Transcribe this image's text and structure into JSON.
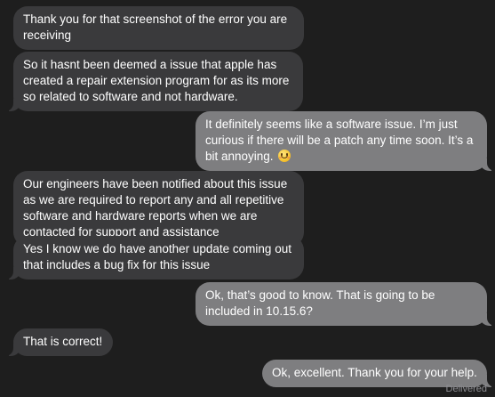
{
  "conversation": {
    "messages": [
      {
        "direction": "incoming",
        "text": "Thank you for that screenshot of the error you are receiving"
      },
      {
        "direction": "incoming",
        "text": "So it hasnt been deemed a issue that apple has created a repair extension program for as its more so related to software and not hardware."
      },
      {
        "direction": "outgoing",
        "text": "It definitely seems like a software issue. I’m just curious if there will be a patch any time soon. It’s a bit annoying.",
        "emoji": "smiling-face-icon"
      },
      {
        "direction": "incoming",
        "text": "Our engineers have been notified about this issue as we are required to report any and all repetitive software and hardware reports when we are contacted for support and assistance"
      },
      {
        "direction": "incoming",
        "text": "Yes I know we do have another update coming out that includes a bug fix for this issue"
      },
      {
        "direction": "outgoing",
        "text": "Ok, that’s good to know. That is going to be included in 10.15.6?"
      },
      {
        "direction": "incoming",
        "text": "That is correct!"
      },
      {
        "direction": "outgoing",
        "text": "Ok, excellent. Thank you for your help."
      }
    ],
    "status": "Delivered"
  },
  "colors": {
    "background": "#1e1e1e",
    "incoming_bubble": "#3a3a3c",
    "outgoing_bubble": "#7e7e80",
    "text": "#ffffff",
    "status_text": "#8e8e93"
  }
}
